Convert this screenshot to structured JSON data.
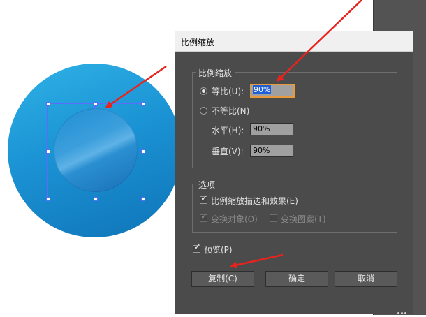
{
  "dialog": {
    "title": "比例缩放",
    "scale_group": {
      "label": "比例缩放",
      "uniform": {
        "label": "等比(U):",
        "value": "90%",
        "selected": true
      },
      "non_uniform": {
        "label": "不等比(N)",
        "selected": false
      },
      "horizontal": {
        "label": "水平(H):",
        "value": "90%"
      },
      "vertical": {
        "label": "垂直(V):",
        "value": "90%"
      }
    },
    "options_group": {
      "label": "选项",
      "scale_strokes": {
        "label": "比例缩放描边和效果(E)",
        "checked": true
      },
      "transform_objects": {
        "label": "变换对象(O)",
        "checked": true,
        "disabled": true
      },
      "transform_patterns": {
        "label": "变换图案(T)",
        "checked": false,
        "disabled": true
      }
    },
    "preview": {
      "label": "预览(P)",
      "checked": true
    },
    "buttons": {
      "copy": "复制(C)",
      "ok": "确定",
      "cancel": "取消"
    }
  },
  "colors": {
    "annotation_arrow": "#e8231e",
    "selection": "#5b6cff",
    "focus_ring": "#e79a3b",
    "dialog_bg": "#4b4b4b"
  },
  "icons": [
    "radio-selected",
    "radio-unselected",
    "checkbox-checked",
    "checkbox-unchecked",
    "annotation-arrow"
  ]
}
